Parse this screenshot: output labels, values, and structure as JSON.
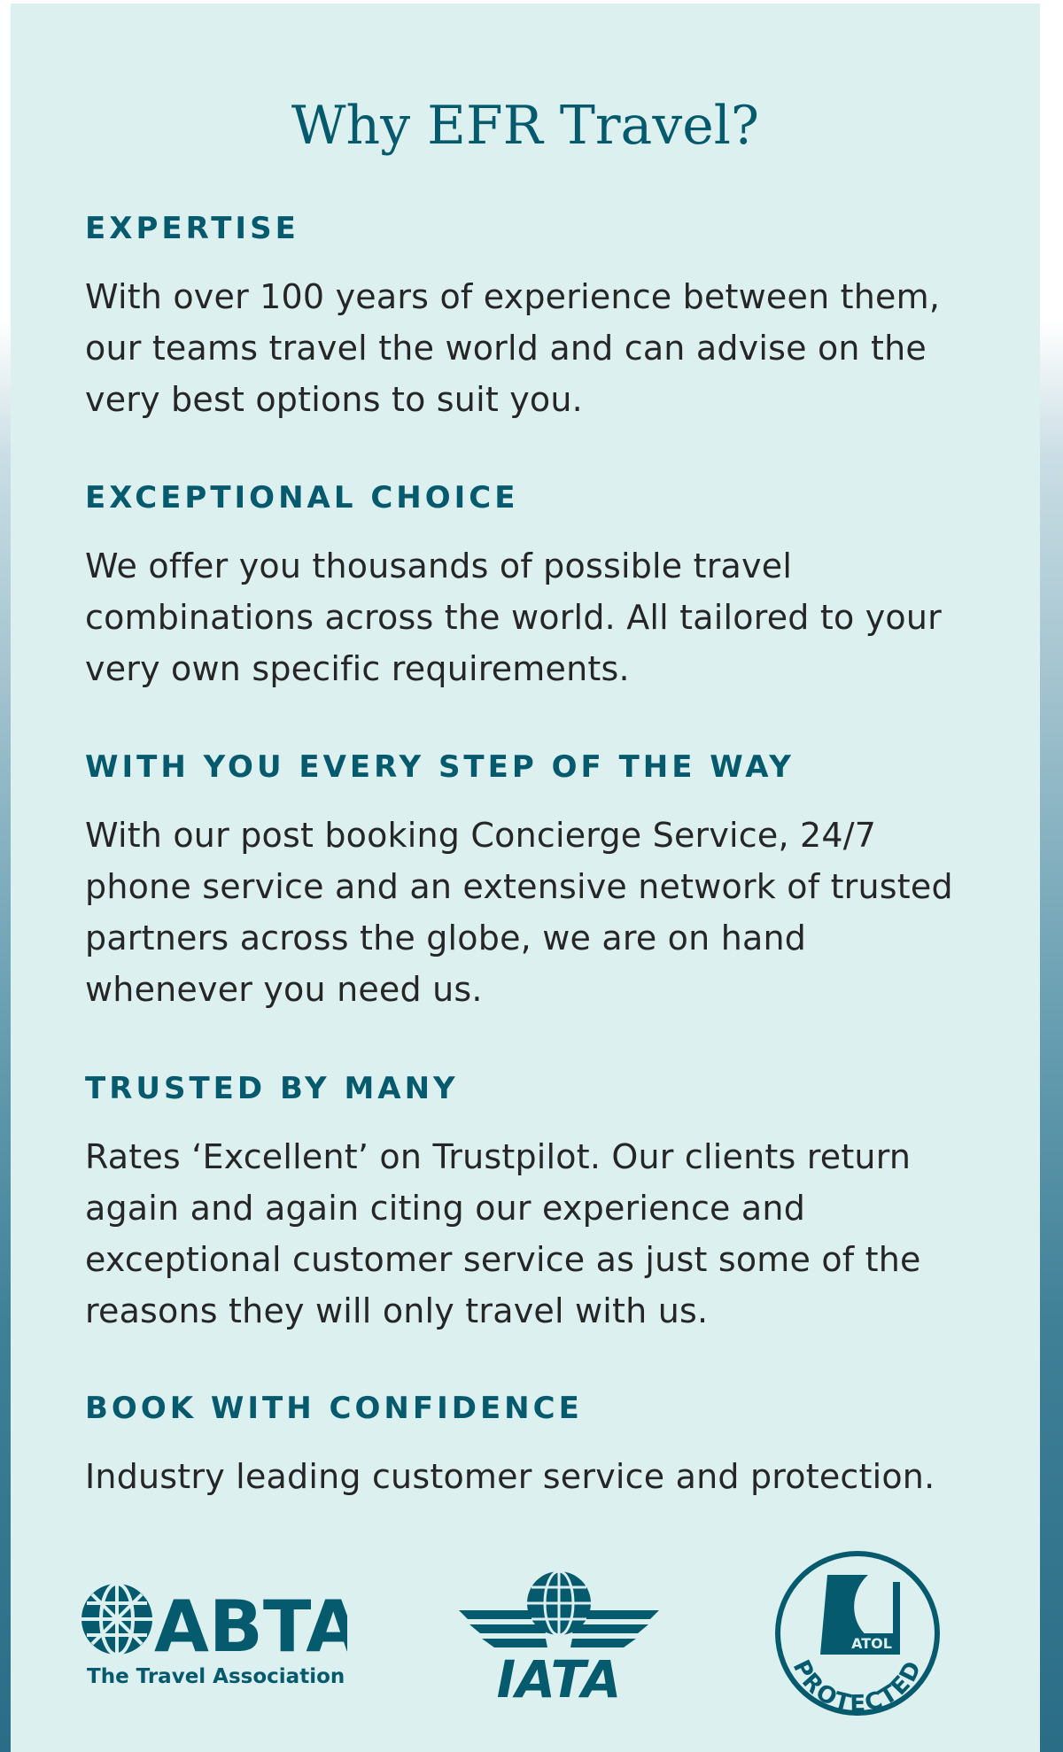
{
  "page": {
    "title": "Why EFR Travel?"
  },
  "sections": [
    {
      "heading": "EXPERTISE",
      "body": "With over 100 years of experience between them, our teams travel the world and can advise on the very best options to suit you."
    },
    {
      "heading": "EXCEPTIONAL CHOICE",
      "body": "We offer you thousands of possible travel combinations across the world. All tailored to your very own specific requirements."
    },
    {
      "heading": "WITH YOU EVERY STEP OF THE WAY",
      "body": "With our post booking Concierge Service, 24/7 phone service and an extensive network of trusted partners across the globe, we are on hand whenever you need us."
    },
    {
      "heading": "TRUSTED BY MANY",
      "body": "Rates ‘Excellent’ on Trustpilot. Our clients return again and again citing our experience and exceptional customer service as just some of the reasons they will only travel with us."
    },
    {
      "heading": "BOOK WITH CONFIDENCE",
      "body": "Industry leading customer service and protection."
    }
  ],
  "logos": {
    "abta": {
      "name": "ABTA",
      "tagline": "The Travel Association"
    },
    "iata": {
      "name": "IATA"
    },
    "atol": {
      "name": "ATOL",
      "tagline": "PROTECTED"
    }
  },
  "colors": {
    "brand": "#065a6e",
    "card_background": "#ddf0f0",
    "body_text": "#262626"
  }
}
